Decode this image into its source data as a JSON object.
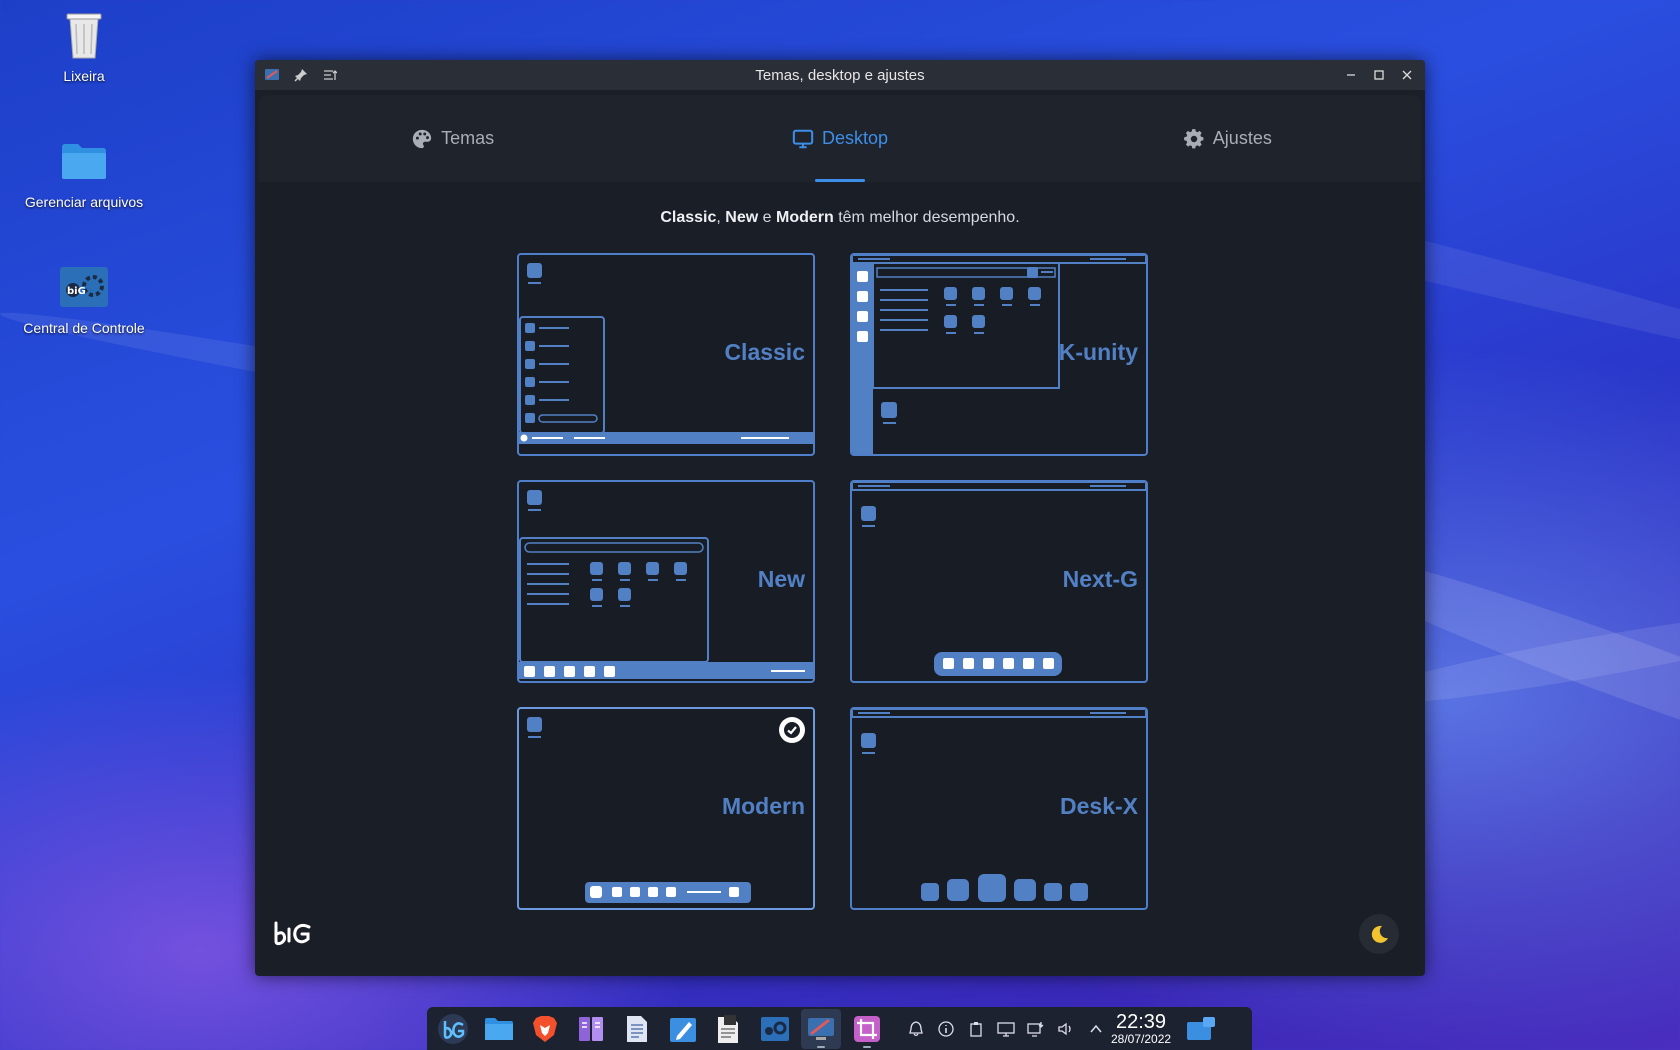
{
  "desktop": {
    "icons": [
      {
        "label": "Lixeira"
      },
      {
        "label": "Gerenciar arquivos"
      },
      {
        "label": "Central de Controle"
      }
    ]
  },
  "window": {
    "title": "Temas, desktop e ajustes",
    "tabs": [
      {
        "label": "Temas",
        "icon": "palette-icon"
      },
      {
        "label": "Desktop",
        "icon": "monitor-icon",
        "active": true
      },
      {
        "label": "Ajustes",
        "icon": "gear-icon"
      }
    ],
    "notice": {
      "bold1": "Classic",
      "sep1": ", ",
      "bold2": "New",
      "sep2": " e ",
      "bold3": "Modern",
      "rest": " têm melhor desempenho."
    },
    "layouts": [
      {
        "name": "Classic"
      },
      {
        "name": "K-unity"
      },
      {
        "name": "New"
      },
      {
        "name": "Next-G"
      },
      {
        "name": "Modern",
        "selected": true
      },
      {
        "name": "Desk-X"
      }
    ],
    "logo": "biG"
  },
  "taskbar": {
    "clock_time": "22:39",
    "clock_date": "28/07/2022"
  },
  "colors": {
    "accent": "#3d8ee8",
    "card_outline": "#4f7fc8",
    "layout_fill": "#5280c4",
    "moon": "#f4c430"
  }
}
